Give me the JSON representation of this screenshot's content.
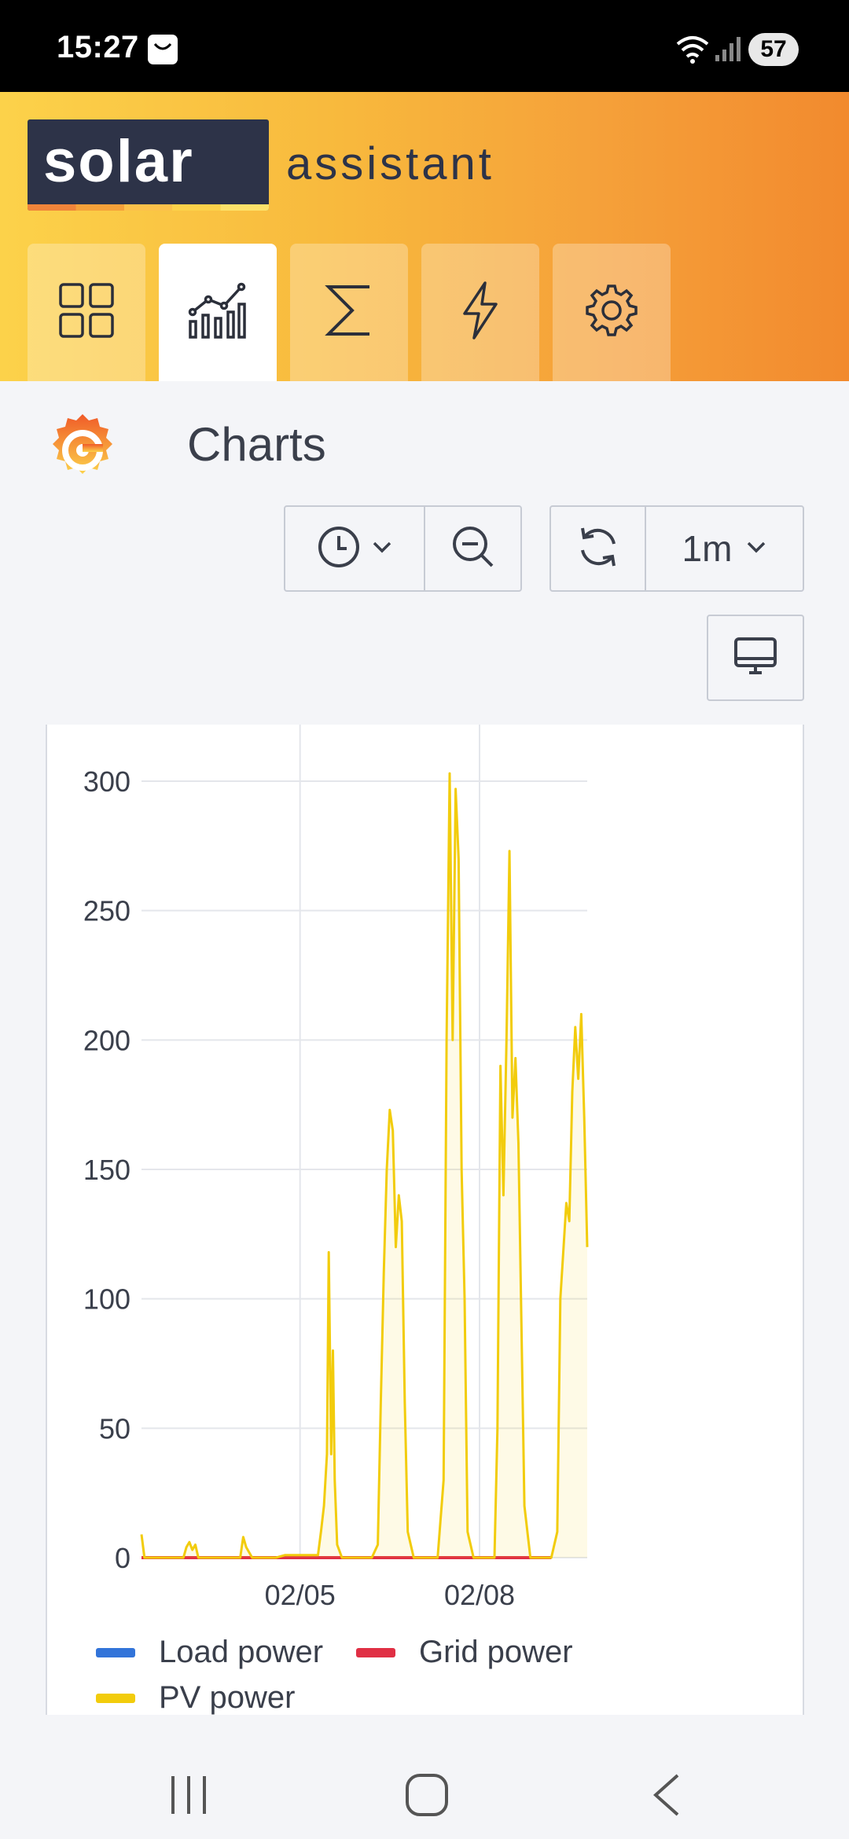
{
  "status_bar": {
    "time": "15:27",
    "battery": "57",
    "icons": [
      "notification-bag-icon",
      "wifi-icon",
      "signal-icon"
    ]
  },
  "app": {
    "logo_primary": "solar",
    "logo_secondary": "assistant",
    "accent_colors": [
      "#fcd24a",
      "#f28a2e",
      "#2d3348"
    ],
    "nav_tabs": [
      {
        "name": "dashboard",
        "icon": "grid-icon",
        "active": false
      },
      {
        "name": "charts",
        "icon": "chart-icon",
        "active": true
      },
      {
        "name": "totals",
        "icon": "sigma-icon",
        "active": false
      },
      {
        "name": "power",
        "icon": "lightning-icon",
        "active": false
      },
      {
        "name": "settings",
        "icon": "gear-icon",
        "active": false
      }
    ]
  },
  "page": {
    "title": "Charts",
    "toolbar": {
      "time_picker_icon": "clock-icon",
      "zoom_out_icon": "zoom-out-icon",
      "refresh_icon": "refresh-icon",
      "refresh_interval": "1m",
      "view_mode_icon": "monitor-icon"
    }
  },
  "chart_data": {
    "type": "line",
    "title": "",
    "xlabel": "",
    "ylabel": "",
    "ylim": [
      0,
      300
    ],
    "yticks": [
      0,
      50,
      100,
      150,
      200,
      250,
      300
    ],
    "xticks": [
      "02/05",
      "02/08"
    ],
    "grid": true,
    "legend_position": "bottom",
    "series": [
      {
        "name": "Load power",
        "color": "#3274d9",
        "values": []
      },
      {
        "name": "Grid power",
        "color": "#e02f44",
        "values": [
          [
            2.35,
            0
          ],
          [
            9.2,
            0
          ]
        ]
      },
      {
        "name": "PV power",
        "color": "#f2cc0c",
        "values": [
          [
            2.35,
            9
          ],
          [
            2.4,
            0
          ],
          [
            3.05,
            0
          ],
          [
            3.1,
            4
          ],
          [
            3.15,
            6
          ],
          [
            3.2,
            3
          ],
          [
            3.25,
            5
          ],
          [
            3.3,
            0
          ],
          [
            4.0,
            0
          ],
          [
            4.05,
            8
          ],
          [
            4.1,
            4
          ],
          [
            4.15,
            2
          ],
          [
            4.2,
            0
          ],
          [
            4.6,
            0
          ],
          [
            4.75,
            1
          ],
          [
            5.3,
            1
          ],
          [
            5.35,
            10
          ],
          [
            5.4,
            20
          ],
          [
            5.45,
            40
          ],
          [
            5.48,
            118
          ],
          [
            5.52,
            40
          ],
          [
            5.55,
            80
          ],
          [
            5.58,
            30
          ],
          [
            5.62,
            5
          ],
          [
            5.7,
            0
          ],
          [
            6.2,
            0
          ],
          [
            6.3,
            5
          ],
          [
            6.35,
            60
          ],
          [
            6.4,
            110
          ],
          [
            6.45,
            150
          ],
          [
            6.5,
            173
          ],
          [
            6.55,
            165
          ],
          [
            6.6,
            120
          ],
          [
            6.65,
            140
          ],
          [
            6.7,
            130
          ],
          [
            6.75,
            60
          ],
          [
            6.8,
            10
          ],
          [
            6.9,
            0
          ],
          [
            7.3,
            0
          ],
          [
            7.4,
            30
          ],
          [
            7.45,
            200
          ],
          [
            7.5,
            303
          ],
          [
            7.55,
            200
          ],
          [
            7.6,
            297
          ],
          [
            7.65,
            270
          ],
          [
            7.7,
            150
          ],
          [
            7.75,
            100
          ],
          [
            7.8,
            10
          ],
          [
            7.9,
            0
          ],
          [
            8.25,
            0
          ],
          [
            8.3,
            50
          ],
          [
            8.35,
            190
          ],
          [
            8.4,
            140
          ],
          [
            8.45,
            200
          ],
          [
            8.5,
            273
          ],
          [
            8.55,
            170
          ],
          [
            8.6,
            193
          ],
          [
            8.65,
            160
          ],
          [
            8.7,
            90
          ],
          [
            8.75,
            20
          ],
          [
            8.85,
            0
          ],
          [
            9.2,
            0
          ],
          [
            9.3,
            10
          ],
          [
            9.35,
            100
          ],
          [
            9.45,
            137
          ],
          [
            9.5,
            130
          ],
          [
            9.55,
            180
          ],
          [
            9.6,
            205
          ],
          [
            9.65,
            185
          ],
          [
            9.7,
            210
          ],
          [
            9.75,
            170
          ],
          [
            9.8,
            120
          ]
        ]
      }
    ]
  }
}
